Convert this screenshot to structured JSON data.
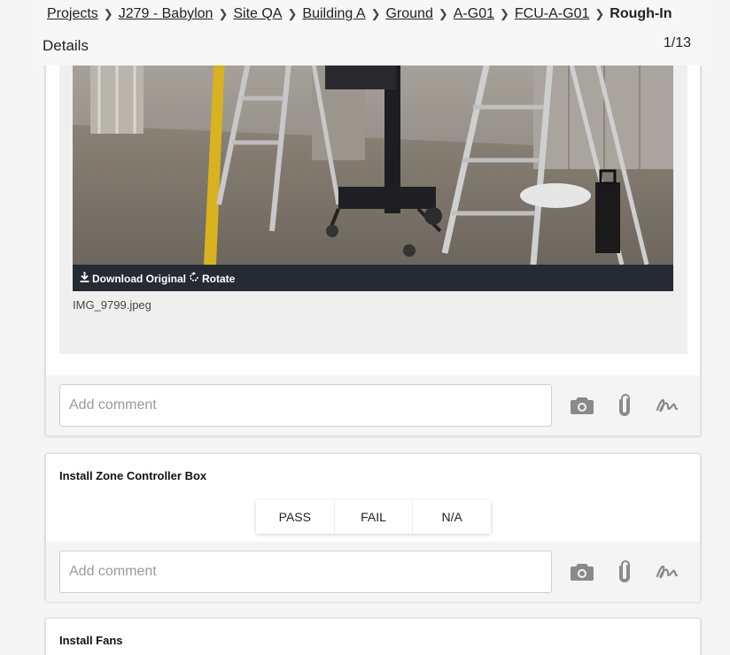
{
  "breadcrumb": {
    "items": [
      "Projects",
      "J279 - Babylon",
      "Site QA",
      "Building A",
      "Ground",
      "A-G01",
      "FCU-A-G01"
    ],
    "current": "Rough-In"
  },
  "header": {
    "title": "Details",
    "counter": "1/13"
  },
  "photo_card": {
    "download_label": "Download Original",
    "rotate_label": "Rotate",
    "file_name": "IMG_9799.jpeg",
    "comment_placeholder": "Add comment"
  },
  "items": [
    {
      "title": "Install Zone Controller Box",
      "options": [
        "PASS",
        "FAIL",
        "N/A"
      ],
      "comment_placeholder": "Add comment"
    },
    {
      "title": "Install Fans"
    }
  ],
  "icons": {
    "camera": "camera-icon",
    "attach": "paperclip-icon",
    "signature": "signature-icon",
    "download": "download-icon",
    "rotate": "rotate-icon"
  },
  "colors": {
    "photo_bar": "#262b33",
    "icon_gray": "#8a8a8a",
    "panel_bg": "#efefef"
  }
}
